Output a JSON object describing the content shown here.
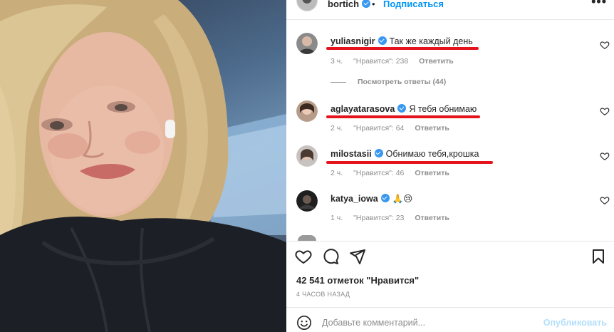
{
  "header": {
    "username": "bortich",
    "separator": "•",
    "follow_label": "Подписаться",
    "more_label": "•••"
  },
  "comments": [
    {
      "username": "yuliasnigir",
      "verified": true,
      "text": "Так же каждый день",
      "time": "3 ч.",
      "likes": "\"Нравится\": 238",
      "reply": "Ответить",
      "highlighted": true
    },
    {
      "username": "aglayatarasova",
      "verified": true,
      "text": "Я тебя обнимаю",
      "time": "2 ч.",
      "likes": "\"Нравится\": 64",
      "reply": "Ответить",
      "highlighted": true
    },
    {
      "username": "milostasii",
      "verified": true,
      "text": "Обнимаю тебя,крошка",
      "time": "2 ч.",
      "likes": "\"Нравится\": 46",
      "reply": "Ответить",
      "highlighted": true
    },
    {
      "username": "katya_iowa",
      "verified": true,
      "text": "🙏😢",
      "time": "1 ч.",
      "likes": "\"Нравится\": 23",
      "reply": "Ответить",
      "highlighted": false
    }
  ],
  "view_replies": "Посмотреть ответы (44)",
  "likes_count": "42 541 отметок \"Нравится\"",
  "post_time": "4 ЧАСОВ НАЗАД",
  "add_comment": {
    "placeholder": "Добавьте комментарий...",
    "publish_label": "Опубликовать"
  },
  "icons": {
    "like": "heart-icon",
    "comment": "comment-icon",
    "share": "send-icon",
    "save": "bookmark-icon",
    "emoji": "emoji-icon",
    "verified": "verified-badge-icon"
  },
  "colors": {
    "accent": "#0095f6",
    "verified": "#3897f0",
    "highlight": "#e5131b",
    "muted": "#8e8e8e"
  }
}
